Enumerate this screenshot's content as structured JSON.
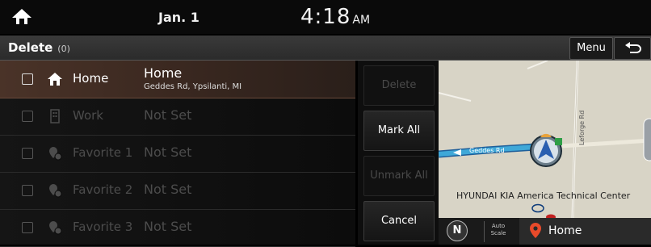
{
  "status": {
    "date": "Jan. 1",
    "time": "4:18",
    "ampm": "AM"
  },
  "header": {
    "title": "Delete",
    "count": "(0)",
    "menu_label": "Menu"
  },
  "rows": [
    {
      "label": "Home",
      "name": "Home",
      "address": "Geddes Rd, Ypsilanti, MI"
    },
    {
      "label": "Work",
      "value": "Not Set"
    },
    {
      "label": "Favorite 1",
      "value": "Not Set"
    },
    {
      "label": "Favorite 2",
      "value": "Not Set"
    },
    {
      "label": "Favorite 3",
      "value": "Not Set"
    }
  ],
  "actions": {
    "delete": "Delete",
    "mark_all": "Mark All",
    "unmark_all": "Unmark All",
    "cancel": "Cancel"
  },
  "map": {
    "road_geddes": "Geddes Rd",
    "road_leforge": "Leforge Rd",
    "poi": "HYUNDAI KIA America Technical Center",
    "compass": "N",
    "autoscale_line1": "Auto",
    "autoscale_line2": "Scale",
    "destination": "Home"
  },
  "colors": {
    "selected_row": "#4a3328",
    "route": "#3fa8d8",
    "accent_pin": "#e84a2a"
  }
}
